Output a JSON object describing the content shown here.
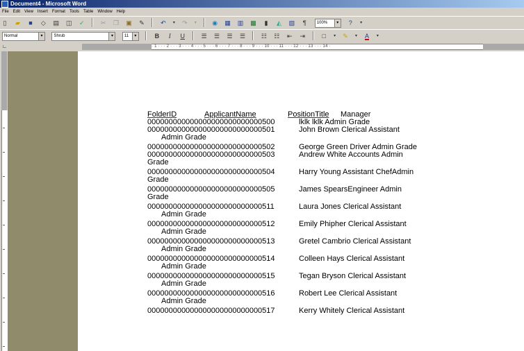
{
  "window": {
    "title": "Document4 - Microsoft Word"
  },
  "menu": [
    "File",
    "Edit",
    "View",
    "Insert",
    "Format",
    "Tools",
    "Table",
    "Window",
    "Help"
  ],
  "format": {
    "style": "Normal",
    "font": "Shrub",
    "size": "11",
    "zoom": "100%"
  },
  "ruler": {
    "ticks": "· 1 · · · 2 · · · 3 · · · 4 · · · 5 · · · 6 · · · 7 · · · 8 · · · 9 · · · 10 · · · 11 · · · 12 · · · 13 · · · 14 ·"
  },
  "document": {
    "header": {
      "c1": "FolderID",
      "c2": "ApplicantName",
      "c3": "PositionTitle",
      "c4": "Manager"
    },
    "rows": [
      {
        "id": "000000000000000000000000000500",
        "rest": "lklk   lklk   Admin Grade",
        "wrap": ""
      },
      {
        "id": "000000000000000000000000000501",
        "rest": "John Brown   Clerical Assistant",
        "wrap": "Admin Grade"
      },
      {
        "id": "000000000000000000000000000502",
        "rest": "George Green Driver  Admin Grade",
        "wrap": ""
      },
      {
        "id": "000000000000000000000000000503",
        "rest": "Andrew White Accounts      Admin",
        "wrap": "Grade"
      },
      {
        "id": "000000000000000000000000000504",
        "rest": "Harry Young   Assistant ChefAdmin",
        "wrap": "Grade"
      },
      {
        "id": "000000000000000000000000000505",
        "rest": "James SpearsEngineer       Admin",
        "wrap": "Grade"
      },
      {
        "id": "000000000000000000000000000511",
        "rest": "Laura Jones   Clerical Assistant",
        "wrap": "Admin Grade"
      },
      {
        "id": "000000000000000000000000000512",
        "rest": "Emily Phipher Clerical Assistant",
        "wrap": "Admin Grade"
      },
      {
        "id": "000000000000000000000000000513",
        "rest": "Gretel Cambrio          Clerical Assistant",
        "wrap": "Admin Grade"
      },
      {
        "id": "000000000000000000000000000514",
        "rest": "Colleen Hays  Clerical Assistant",
        "wrap": "Admin Grade"
      },
      {
        "id": "000000000000000000000000000515",
        "rest": "Tegan Bryson Clerical Assistant",
        "wrap": "Admin Grade"
      },
      {
        "id": "000000000000000000000000000516",
        "rest": "Robert Lee     Clerical Assistant",
        "wrap": "Admin Grade"
      },
      {
        "id": "000000000000000000000000000517",
        "rest": "Kerry Whitely  Clerical Assistant",
        "wrap": ""
      }
    ]
  }
}
